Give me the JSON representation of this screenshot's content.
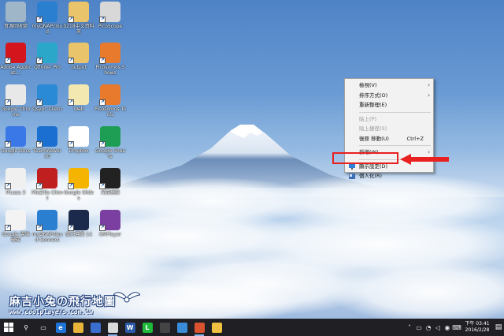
{
  "desktop_icons": [
    {
      "label": "資源回收筒",
      "icon": "recycle-bin-icon",
      "color": "#9fb6c8"
    },
    {
      "label": "myQNAPcloud",
      "icon": "myqnapcloud-icon",
      "color": "#2b7fd0"
    },
    {
      "label": "0218中文資料夾",
      "icon": "folder-icon",
      "color": "#e9c46a"
    },
    {
      "label": "PicoScope",
      "icon": "picoscope-icon",
      "color": "#d8d8d8"
    },
    {
      "label": "Adobe Applicati...",
      "icon": "adobe-icon",
      "color": "#d4161c"
    },
    {
      "label": "Qfinder Pro",
      "icon": "qfinder-icon",
      "color": "#2ba7c9"
    },
    {
      "label": "output",
      "icon": "folder-icon",
      "color": "#e9c46a"
    },
    {
      "label": "Picosomos Shows",
      "icon": "picosomos-icon",
      "color": "#e87a2e"
    },
    {
      "label": "Google Chrome",
      "icon": "chrome-icon",
      "color": "#e8e8e8"
    },
    {
      "label": "Qsync Client",
      "icon": "qsync-icon",
      "color": "#2b8ad6"
    },
    {
      "label": "Web",
      "icon": "document-icon",
      "color": "#f3e9b0"
    },
    {
      "label": "Picosomos Tools",
      "icon": "picosomos-tools-icon",
      "color": "#e87a2e"
    },
    {
      "label": "Google Docs",
      "icon": "google-docs-icon",
      "color": "#3b78e7"
    },
    {
      "label": "TeamViewer 10",
      "icon": "teamviewer-icon",
      "color": "#1a6fd1"
    },
    {
      "label": "Dropbox",
      "icon": "dropbox-icon",
      "color": "#ffffff"
    },
    {
      "label": "Google Sheets",
      "icon": "google-sheets-icon",
      "color": "#1e9e55"
    },
    {
      "label": "Picasa 3",
      "icon": "picasa-icon",
      "color": "#f0f0f0"
    },
    {
      "label": "FileZilla Client",
      "icon": "filezilla-icon",
      "color": "#bf1f1f"
    },
    {
      "label": "Google Slides",
      "icon": "google-slides-icon",
      "color": "#f4b400"
    },
    {
      "label": "光碟燒錄",
      "icon": "disc-burner-icon",
      "color": "#222222"
    },
    {
      "label": "Google 雲端硬碟",
      "icon": "google-drive-icon",
      "color": "#f3f3f3"
    },
    {
      "label": "myQNAPcloud Connect",
      "icon": "myqnapcloud-connect-icon",
      "color": "#2b7fd0"
    },
    {
      "label": "威力導演 14",
      "icon": "powerdirector-icon",
      "color": "#1b2a4a"
    },
    {
      "label": "KMPlayer",
      "icon": "kmplayer-icon",
      "color": "#7a3fa0"
    }
  ],
  "context_menu": {
    "items": [
      {
        "label": "檢視(V)",
        "submenu": true,
        "disabled": false
      },
      {
        "label": "排序方式(O)",
        "submenu": true,
        "disabled": false
      },
      {
        "label": "重新整理(E)",
        "submenu": false,
        "disabled": false
      },
      {
        "sep": true
      },
      {
        "label": "貼上(P)",
        "submenu": false,
        "disabled": true
      },
      {
        "label": "貼上捷徑(S)",
        "submenu": false,
        "disabled": true
      },
      {
        "label": "復原 移動(U)",
        "submenu": false,
        "disabled": false,
        "shortcut": "Ctrl+Z"
      },
      {
        "sep": true
      },
      {
        "label": "新增(W)",
        "submenu": true,
        "disabled": false
      },
      {
        "sep": true
      },
      {
        "label": "顯示設定(D)",
        "submenu": false,
        "disabled": false,
        "icon": "display-icon",
        "highlighted": true
      },
      {
        "label": "個人化(R)",
        "submenu": false,
        "disabled": false,
        "icon": "personalize-icon"
      }
    ]
  },
  "watermark": {
    "title": "麻吉小兔の飛行地圖",
    "url": "www.coolplayers.com.tw"
  },
  "taskbar": {
    "pinned": [
      {
        "name": "taskbar-search-icon",
        "glyph": "⚲",
        "color": "#1f1f24"
      },
      {
        "name": "taskbar-task-view-icon",
        "glyph": "▭",
        "color": "#1f1f24"
      },
      {
        "name": "taskbar-edge-icon",
        "glyph": "e",
        "color": "#1e73d8"
      },
      {
        "name": "taskbar-file-explorer-icon",
        "glyph": "",
        "color": "#e8b53a"
      },
      {
        "name": "taskbar-store-icon",
        "glyph": "",
        "color": "#3a6fd0"
      },
      {
        "name": "taskbar-chrome-icon",
        "glyph": "",
        "color": "#dadada"
      },
      {
        "name": "taskbar-word-icon",
        "glyph": "W",
        "color": "#2b5aa8"
      },
      {
        "name": "taskbar-line-icon",
        "glyph": "L",
        "color": "#1fba3a"
      },
      {
        "name": "taskbar-calculator-icon",
        "glyph": "",
        "color": "#444444"
      },
      {
        "name": "taskbar-photos-icon",
        "glyph": "",
        "color": "#3a8bd8"
      },
      {
        "name": "taskbar-picosomos-icon",
        "glyph": "",
        "color": "#d8532e"
      },
      {
        "name": "taskbar-paint-icon",
        "glyph": "",
        "color": "#f0c040"
      }
    ],
    "clock_time": "下午 03:41",
    "clock_date": "2016/2/28"
  },
  "colors": {
    "highlight_red": "#e8201f",
    "taskbar_bg": "#1f1f24",
    "menu_bg": "#f2f2f2"
  }
}
